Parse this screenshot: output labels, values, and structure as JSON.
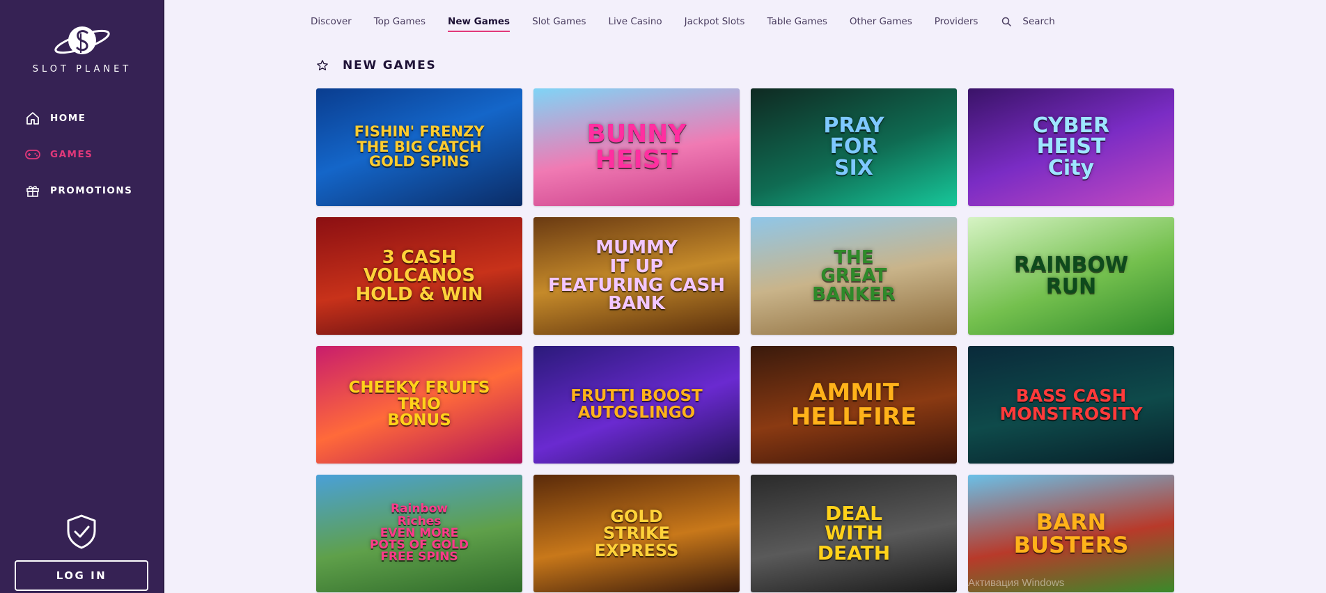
{
  "brand": {
    "name": "SLOT PLANET"
  },
  "sidebar": {
    "items": [
      {
        "label": "HOME",
        "icon": "home-icon"
      },
      {
        "label": "GAMES",
        "icon": "gamepad-icon",
        "active": true
      },
      {
        "label": "PROMOTIONS",
        "icon": "gift-icon"
      }
    ],
    "login_label": "LOG IN"
  },
  "topnav": {
    "tabs": [
      "Discover",
      "Top Games",
      "New Games",
      "Slot Games",
      "Live Casino",
      "Jackpot Slots",
      "Table Games",
      "Other Games",
      "Providers"
    ],
    "active_tab": "New Games",
    "search_label": "Search"
  },
  "section": {
    "title": "NEW GAMES"
  },
  "games": [
    {
      "title": "FISHIN' FRENZY\nTHE BIG CATCH\nGOLD SPINS",
      "bg": "linear-gradient(160deg,#0a3d8f 0%,#1466c9 45%,#0b2c66 100%)",
      "color": "#ffcc2e",
      "size": 21
    },
    {
      "title": "BUNNY\nHEIST",
      "bg": "linear-gradient(170deg,#7fd4f6 0%,#f07ab3 55%,#c73a86 100%)",
      "color": "#ff2fa0",
      "size": 36
    },
    {
      "title": "PRAY\nFOR\nSIX",
      "bg": "linear-gradient(160deg,#0f2a22 0%,#0f6b52 55%,#17c79a 100%)",
      "color": "#7ec8ff",
      "size": 30
    },
    {
      "title": "CYBER\nHEIST\nCity",
      "bg": "linear-gradient(160deg,#3a1368 0%,#7a2cc4 50%,#c44ac0 100%)",
      "color": "#9ee6ff",
      "size": 30
    },
    {
      "title": "3 CASH\nVOLCANOS\nHOLD & WIN",
      "bg": "linear-gradient(170deg,#8b0f12 0%,#c8321a 55%,#5a0b12 100%)",
      "color": "#ffd23a",
      "size": 26
    },
    {
      "title": "MUMMY\nIT UP\nFEATURING CASH BANK",
      "bg": "linear-gradient(170deg,#6a3a12 0%,#c58a2a 50%,#5a2f0c 100%)",
      "color": "#f3c7ff",
      "size": 26
    },
    {
      "title": "THE\nGREAT\nBANKER",
      "bg": "linear-gradient(170deg,#8fc6e8 0%,#c9b48a 50%,#8b6a3a 100%)",
      "color": "#2f8a2a",
      "size": 26
    },
    {
      "title": "RAINBOW\nRUN",
      "bg": "linear-gradient(160deg,#d6f3c4 0%,#74c04e 55%,#2f8a2a 100%)",
      "color": "#0e4a1c",
      "size": 30
    },
    {
      "title": "CHEEKY FRUITS\nTRIO\nBONUS",
      "bg": "linear-gradient(160deg,#c81d6c 0%,#ff6a3a 50%,#b0125a 100%)",
      "color": "#ffd21a",
      "size": 23
    },
    {
      "title": "FRUTTI BOOST\nAUTOSLINGO",
      "bg": "linear-gradient(160deg,#2b1a7a 0%,#6a2ad0 55%,#25125a 100%)",
      "color": "#ffb21a",
      "size": 23
    },
    {
      "title": "AMMIT\nHELLFIRE",
      "bg": "linear-gradient(170deg,#3a1a0c 0%,#8a3a12 55%,#3a140a 100%)",
      "color": "#ffb21a",
      "size": 34
    },
    {
      "title": "BASS CASH\nMONSTROSITY",
      "bg": "linear-gradient(170deg,#0a2a3a 0%,#0e4a4a 55%,#08202a 100%)",
      "color": "#ff3a3a",
      "size": 25
    },
    {
      "title": "Rainbow\nRiches\nEVEN MORE\nPOTS OF GOLD\nFREE SPINS",
      "bg": "linear-gradient(170deg,#4aa0d8 0%,#5fa04a 55%,#2f6a2a 100%)",
      "color": "#ff3a8a",
      "size": 17
    },
    {
      "title": "GOLD\nSTRIKE\nEXPRESS",
      "bg": "linear-gradient(170deg,#5a2a0a 0%,#c8781a 55%,#3a1a0a 100%)",
      "color": "#ffd23a",
      "size": 24
    },
    {
      "title": "DEAL\nWITH\nDEATH",
      "bg": "linear-gradient(170deg,#2a2a2a 0%,#5a5a5a 55%,#1a1a1a 100%)",
      "color": "#ffd21a",
      "size": 28
    },
    {
      "title": "BARN\nBUSTERS",
      "bg": "linear-gradient(170deg,#6ac0e8 0%,#b83a2a 55%,#3a8a2a 100%)",
      "color": "#ffb21a",
      "size": 32
    }
  ],
  "watermark": "Активация Windows",
  "colors": {
    "sidebar_bg": "#362254",
    "accent": "#e2387a",
    "page_bg": "#f3f0fb"
  }
}
